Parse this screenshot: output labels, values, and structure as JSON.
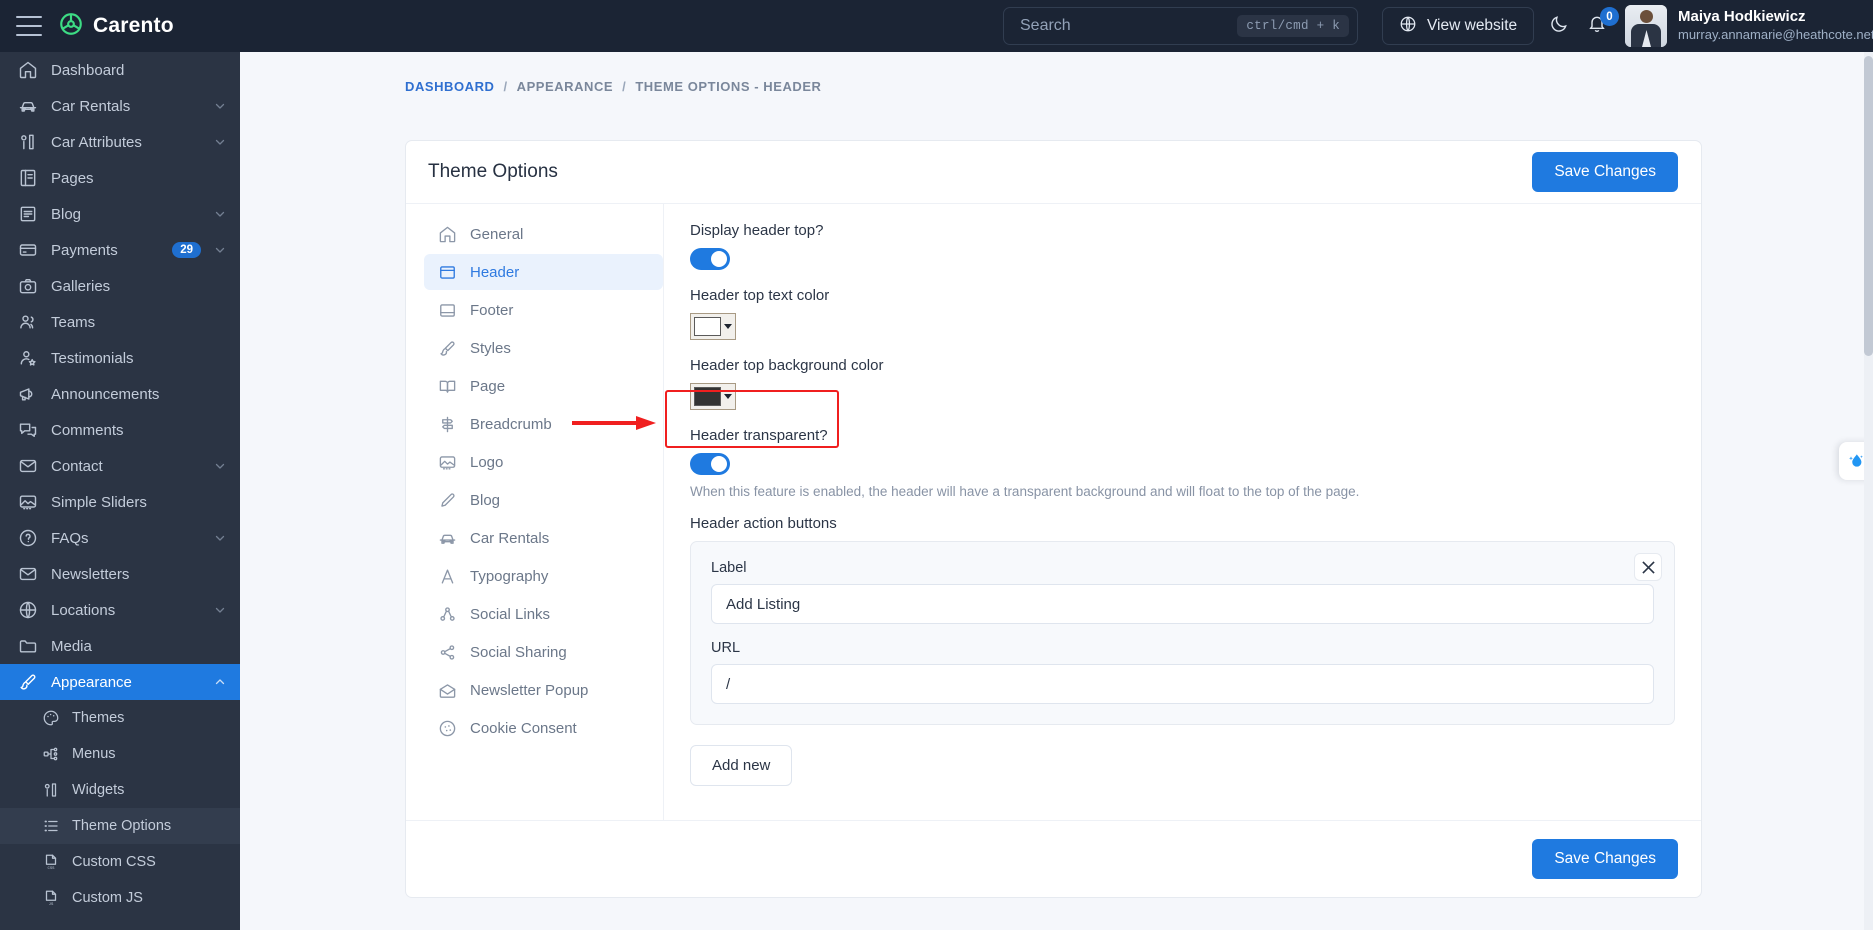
{
  "topbar": {
    "brand": "Carento",
    "search_placeholder": "Search",
    "search_value": "",
    "shortcut": "ctrl/cmd + k",
    "view_website": "View website",
    "notifications_count": "0",
    "user_name": "Maiya Hodkiewicz",
    "user_email": "murray.annamarie@heathcote.net"
  },
  "sidebar": {
    "items": [
      {
        "label": "Dashboard",
        "icon": "home-icon",
        "chevron": false,
        "badge": "",
        "active": false
      },
      {
        "label": "Car Rentals",
        "icon": "car-icon",
        "chevron": true,
        "badge": "",
        "active": false
      },
      {
        "label": "Car Attributes",
        "icon": "attributes-icon",
        "chevron": true,
        "badge": "",
        "active": false
      },
      {
        "label": "Pages",
        "icon": "pages-icon",
        "chevron": false,
        "badge": "",
        "active": false
      },
      {
        "label": "Blog",
        "icon": "blog-icon",
        "chevron": true,
        "badge": "",
        "active": false
      },
      {
        "label": "Payments",
        "icon": "card-icon",
        "chevron": true,
        "badge": "29",
        "active": false
      },
      {
        "label": "Galleries",
        "icon": "camera-icon",
        "chevron": false,
        "badge": "",
        "active": false
      },
      {
        "label": "Teams",
        "icon": "users-icon",
        "chevron": false,
        "badge": "",
        "active": false
      },
      {
        "label": "Testimonials",
        "icon": "user-star-icon",
        "chevron": false,
        "badge": "",
        "active": false
      },
      {
        "label": "Announcements",
        "icon": "megaphone-icon",
        "chevron": false,
        "badge": "",
        "active": false
      },
      {
        "label": "Comments",
        "icon": "comments-icon",
        "chevron": false,
        "badge": "",
        "active": false
      },
      {
        "label": "Contact",
        "icon": "mail-icon",
        "chevron": true,
        "badge": "",
        "active": false
      },
      {
        "label": "Simple Sliders",
        "icon": "image-icon",
        "chevron": false,
        "badge": "",
        "active": false
      },
      {
        "label": "FAQs",
        "icon": "question-icon",
        "chevron": true,
        "badge": "",
        "active": false
      },
      {
        "label": "Newsletters",
        "icon": "mail-icon",
        "chevron": false,
        "badge": "",
        "active": false
      },
      {
        "label": "Locations",
        "icon": "globe-icon",
        "chevron": true,
        "badge": "",
        "active": false
      },
      {
        "label": "Media",
        "icon": "folder-icon",
        "chevron": false,
        "badge": "",
        "active": false
      },
      {
        "label": "Appearance",
        "icon": "brush-icon",
        "chevron": true,
        "chevron_up": true,
        "badge": "",
        "active": true
      }
    ],
    "sub_items": [
      {
        "label": "Themes",
        "icon": "palette-icon",
        "selected": false
      },
      {
        "label": "Menus",
        "icon": "sitemap-icon",
        "selected": false
      },
      {
        "label": "Widgets",
        "icon": "widgets-icon",
        "selected": false
      },
      {
        "label": "Theme Options",
        "icon": "list-icon",
        "selected": true
      },
      {
        "label": "Custom CSS",
        "icon": "css-file-icon",
        "selected": false
      },
      {
        "label": "Custom JS",
        "icon": "js-file-icon",
        "selected": false
      }
    ]
  },
  "breadcrumb": {
    "root": "DASHBOARD",
    "sep": "/",
    "parent": "APPEARANCE",
    "current": "THEME OPTIONS - HEADER"
  },
  "card": {
    "title": "Theme Options",
    "save_top": "Save Changes",
    "save_bottom": "Save Changes"
  },
  "tabs": [
    {
      "label": "General",
      "icon": "home-icon",
      "active": false
    },
    {
      "label": "Header",
      "icon": "header-layout-icon",
      "active": true
    },
    {
      "label": "Footer",
      "icon": "footer-layout-icon",
      "active": false
    },
    {
      "label": "Styles",
      "icon": "brush-icon",
      "active": false
    },
    {
      "label": "Page",
      "icon": "book-icon",
      "active": false
    },
    {
      "label": "Breadcrumb",
      "icon": "signpost-icon",
      "active": false
    },
    {
      "label": "Logo",
      "icon": "image-icon",
      "active": false
    },
    {
      "label": "Blog",
      "icon": "pencil-icon",
      "active": false
    },
    {
      "label": "Car Rentals",
      "icon": "car-icon",
      "active": false
    },
    {
      "label": "Typography",
      "icon": "typography-icon",
      "active": false
    },
    {
      "label": "Social Links",
      "icon": "network-icon",
      "active": false
    },
    {
      "label": "Social Sharing",
      "icon": "share-icon",
      "active": false
    },
    {
      "label": "Newsletter Popup",
      "icon": "open-mail-icon",
      "active": false
    },
    {
      "label": "Cookie Consent",
      "icon": "cookie-icon",
      "active": false
    }
  ],
  "form": {
    "display_header_top_label": "Display header top?",
    "display_header_top_on": true,
    "header_top_text_color_label": "Header top text color",
    "header_top_text_color_value": "#ffffff",
    "header_top_bg_color_label": "Header top background color",
    "header_top_bg_color_value": "#333333",
    "header_transparent_label": "Header transparent?",
    "header_transparent_on": true,
    "header_transparent_help": "When this feature is enabled, the header will have a transparent background and will float to the top of the page.",
    "header_action_buttons_label": "Header action buttons",
    "repeater": {
      "label_label": "Label",
      "label_value": "Add Listing",
      "url_label": "URL",
      "url_value": "/",
      "close_icon": "close-icon"
    },
    "add_new": "Add new"
  },
  "annotation": {
    "highlight_color": "#f01f1f",
    "arrow_icon": "red-arrow-icon"
  },
  "side_widget": {
    "icon": "water-drop-sparkle-icon"
  }
}
